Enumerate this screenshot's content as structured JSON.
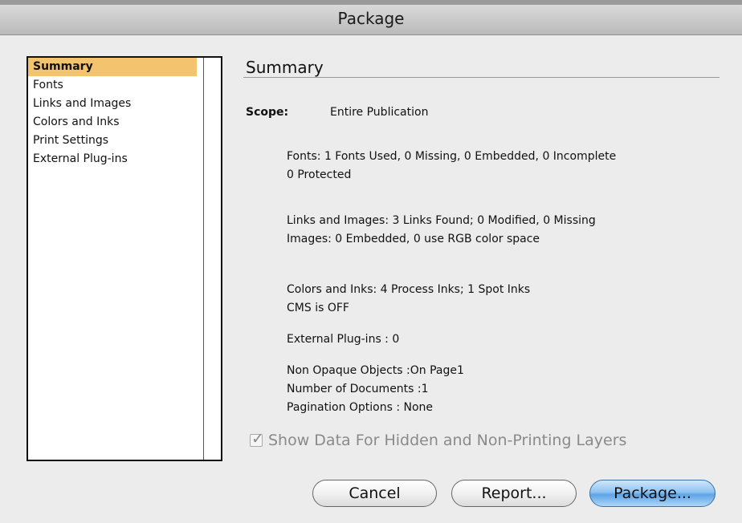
{
  "window": {
    "title": "Package"
  },
  "sidebar": {
    "items": [
      {
        "label": "Summary",
        "selected": true
      },
      {
        "label": "Fonts",
        "selected": false
      },
      {
        "label": "Links and Images",
        "selected": false
      },
      {
        "label": "Colors and Inks",
        "selected": false
      },
      {
        "label": "Print Settings",
        "selected": false
      },
      {
        "label": "External Plug-ins",
        "selected": false
      }
    ]
  },
  "summary": {
    "title": "Summary",
    "scope_label": "Scope:",
    "scope_value": "Entire Publication",
    "fonts_line1": "Fonts: 1 Fonts Used, 0 Missing, 0 Embedded, 0 Incomplete",
    "fonts_line2": "0 Protected",
    "links_line1": "Links and Images: 3 Links Found; 0 Modified, 0 Missing",
    "links_line2": "Images: 0 Embedded, 0 use RGB color space",
    "colors_line1": "Colors and Inks: 4 Process Inks; 1 Spot Inks",
    "colors_line2": "CMS is OFF",
    "plugins_line": "External Plug-ins : 0",
    "nonopaque_line": "Non Opaque Objects :On Page1",
    "documents_line": "Number of Documents :1",
    "pagination_line": "Pagination Options : None"
  },
  "options": {
    "show_hidden_label": "Show Data For Hidden and Non-Printing Layers",
    "show_hidden_checked": true,
    "show_hidden_enabled": false
  },
  "buttons": {
    "cancel": "Cancel",
    "report": "Report...",
    "package": "Package..."
  }
}
